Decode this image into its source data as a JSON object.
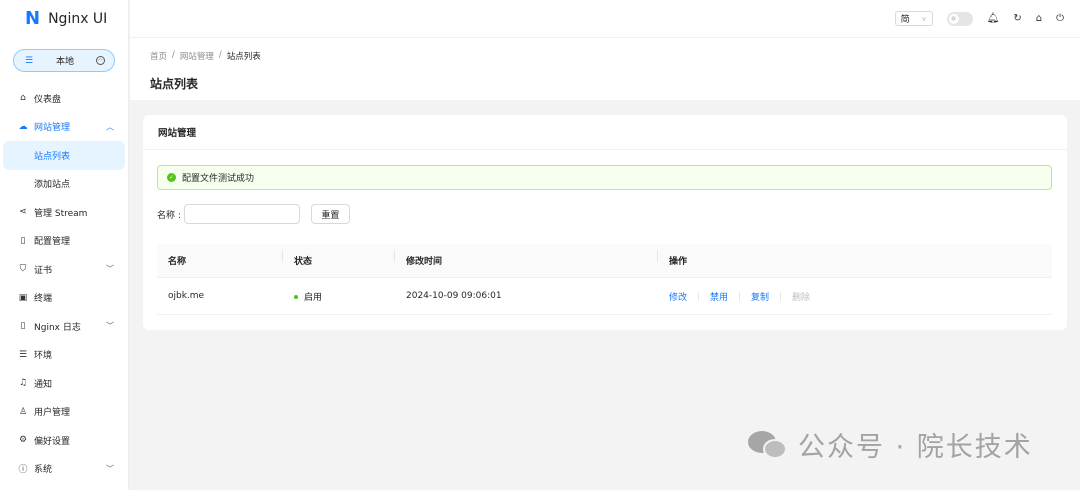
{
  "app": {
    "logo_mark": "N",
    "title": "Nginx UI"
  },
  "env_switch": {
    "label": "本地"
  },
  "sidebar": {
    "items": [
      {
        "icon": "home-icon",
        "label": "仪表盘"
      },
      {
        "icon": "cloud-icon",
        "label": "网站管理",
        "expanded": true,
        "children": [
          {
            "label": "站点列表",
            "active": true
          },
          {
            "label": "添加站点"
          }
        ]
      },
      {
        "icon": "share-icon",
        "label": "管理 Stream"
      },
      {
        "icon": "file-icon",
        "label": "配置管理"
      },
      {
        "icon": "shield-icon",
        "label": "证书",
        "has_children": true
      },
      {
        "icon": "terminal-icon",
        "label": "终端"
      },
      {
        "icon": "file-icon",
        "label": "Nginx 日志",
        "has_children": true
      },
      {
        "icon": "list-icon",
        "label": "环境"
      },
      {
        "icon": "bell-icon",
        "label": "通知"
      },
      {
        "icon": "user-icon",
        "label": "用户管理"
      },
      {
        "icon": "gear-icon",
        "label": "偏好设置"
      },
      {
        "icon": "info-icon",
        "label": "系统",
        "has_children": true
      }
    ]
  },
  "header": {
    "lang": "简"
  },
  "breadcrumb": [
    "首页",
    "网站管理",
    "站点列表"
  ],
  "page_title": "站点列表",
  "card": {
    "title": "网站管理",
    "alert": "配置文件测试成功",
    "search_label": "名称 :",
    "search_value": "",
    "reset_label": "重置",
    "columns": [
      "名称",
      "状态",
      "修改时间",
      "操作"
    ],
    "rows": [
      {
        "name": "ojbk.me",
        "status": "启用",
        "modified": "2024-10-09 09:06:01",
        "actions": [
          "修改",
          "禁用",
          "复制",
          "删除"
        ]
      }
    ]
  },
  "watermark": {
    "text": "公众号 · 院长技术"
  },
  "colors": {
    "primary": "#1677ff",
    "success": "#52c41a",
    "alert_bg": "#f6ffed"
  }
}
